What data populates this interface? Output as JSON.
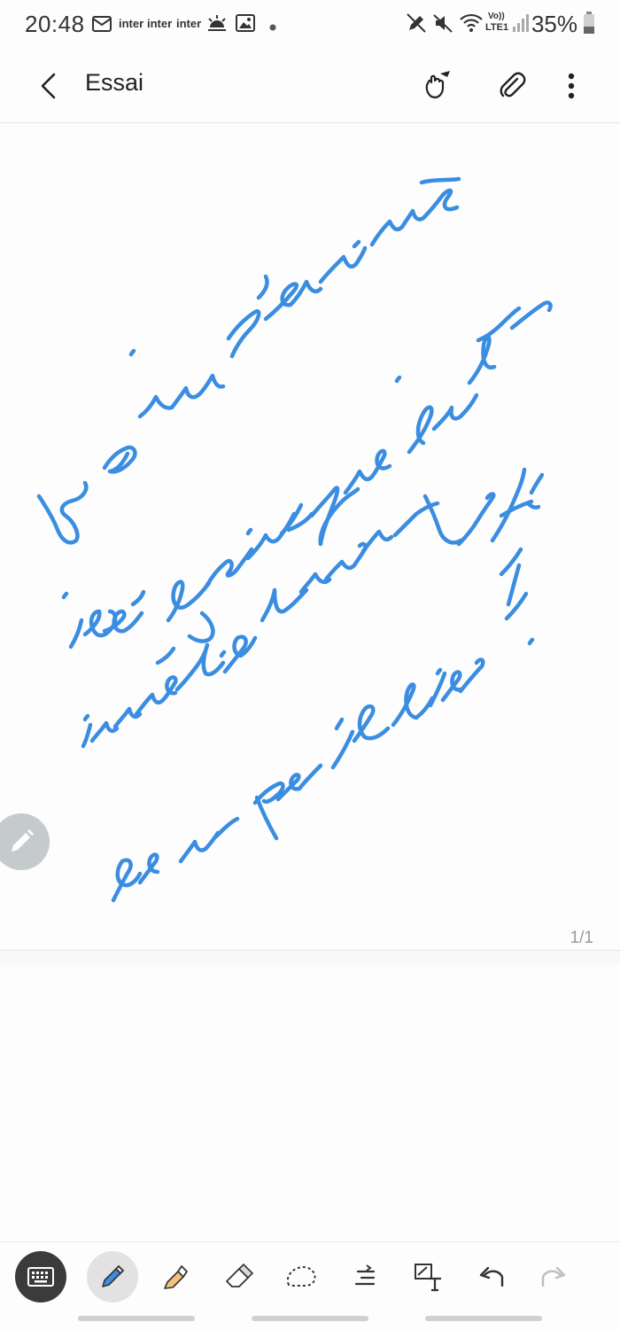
{
  "status_bar": {
    "time": "20:48",
    "notifications": [
      "inter",
      "inter",
      "inter"
    ],
    "network_label_top": "Vo))",
    "network_label_bottom": "LTE1",
    "battery": "35%",
    "icons": [
      "mail-icon",
      "weather-icon",
      "image-icon",
      "dot-icon",
      "pen-off-icon",
      "mute-icon",
      "wifi-icon",
      "signal-icon",
      "battery-icon"
    ]
  },
  "app_bar": {
    "title": "Essai",
    "icons": [
      "back-icon",
      "touch-draw-icon",
      "attach-icon",
      "more-icon"
    ]
  },
  "note": {
    "handwriting_color": "#3a8de0",
    "page_indicator": "1/1"
  },
  "toolbar": {
    "tools": [
      "keyboard-icon",
      "pen-icon",
      "highlighter-icon",
      "eraser-icon",
      "lasso-icon",
      "text-align-icon",
      "handwriting-to-text-icon",
      "undo-icon",
      "redo-icon"
    ],
    "active_tool": "pen-icon"
  }
}
